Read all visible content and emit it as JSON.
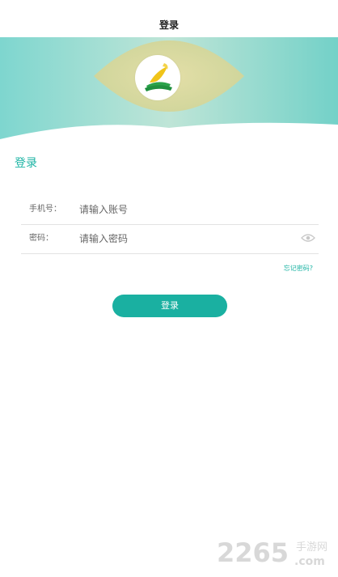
{
  "header": {
    "title": "登录"
  },
  "login": {
    "section_title": "登录",
    "phone": {
      "label": "手机号：",
      "placeholder": "请输入账号",
      "value": ""
    },
    "password": {
      "label": "密码：",
      "placeholder": "请输入密码",
      "value": "",
      "toggle_icon": "eye-icon"
    },
    "forgot_label": "忘记密码?",
    "submit_label": "登录"
  },
  "watermark": {
    "text": "2265手游网",
    "domain": ".com"
  },
  "colors": {
    "accent": "#1bb3a3",
    "button": "#1ab0a1",
    "hero_teal": "#6fd5cb",
    "hero_olive": "#d8d69a"
  }
}
